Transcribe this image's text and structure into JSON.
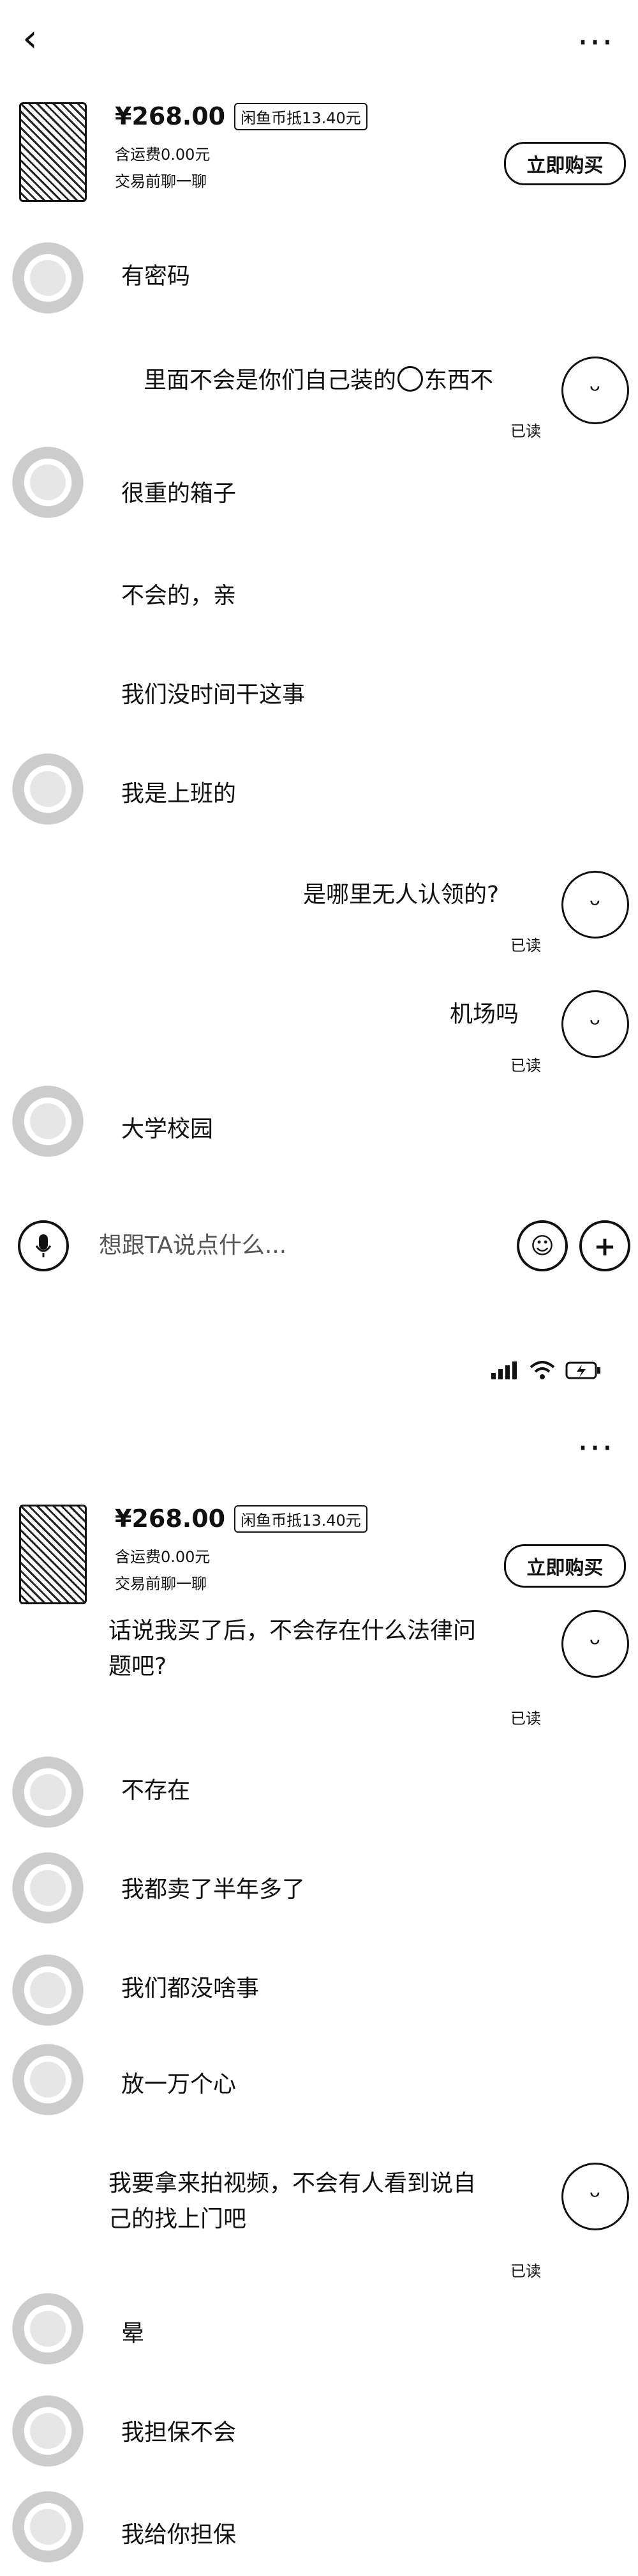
{
  "screen1": {
    "product": {
      "price": "¥268.00",
      "coin_deduct": "闲鱼币抵13.40元",
      "shipping": "含运费0.00元",
      "hint": "交易前聊一聊",
      "buy_label": "立即购买"
    },
    "messages": [
      {
        "side": "left",
        "text": "有密码"
      },
      {
        "side": "right",
        "text_before": "里面不会是你们自己装的",
        "text_after": "东西不",
        "read": "已读"
      },
      {
        "side": "left",
        "text": "很重的箱子"
      },
      {
        "side": "left",
        "text": "不会的，亲"
      },
      {
        "side": "left",
        "text": "我们没时间干这事"
      },
      {
        "side": "left",
        "text": "我是上班的"
      },
      {
        "side": "right",
        "text": "是哪里无人认领的?",
        "read": "已读"
      },
      {
        "side": "right",
        "text": "机场吗",
        "read": "已读"
      },
      {
        "side": "left",
        "text": "大学校园"
      }
    ],
    "input_placeholder": "想跟TA说点什么..."
  },
  "screen2": {
    "product": {
      "price": "¥268.00",
      "coin_deduct": "闲鱼币抵13.40元",
      "shipping": "含运费0.00元",
      "hint": "交易前聊一聊",
      "buy_label": "立即购买"
    },
    "messages": [
      {
        "side": "right",
        "line1": "话说我买了后，不会存在什么法律问",
        "line2": "题吧?",
        "read": "已读"
      },
      {
        "side": "left",
        "text": "不存在"
      },
      {
        "side": "left",
        "text": "我都卖了半年多了"
      },
      {
        "side": "left",
        "text": "我们都没啥事"
      },
      {
        "side": "left",
        "text": "放一万个心"
      },
      {
        "side": "right",
        "line1": "我要拿来拍视频，不会有人看到说自",
        "line2": "己的找上门吧",
        "read": "已读"
      },
      {
        "side": "left",
        "text": "晕"
      },
      {
        "side": "left",
        "text": "我担保不会"
      },
      {
        "side": "left",
        "text": "我给你担保"
      }
    ]
  }
}
